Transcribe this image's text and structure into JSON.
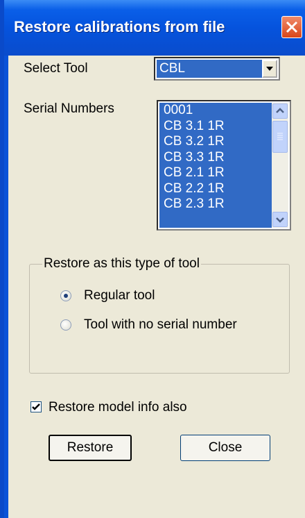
{
  "window": {
    "title": "Restore calibrations from file"
  },
  "select_tool": {
    "label": "Select Tool",
    "value": "CBL"
  },
  "serial_numbers": {
    "label": "Serial Numbers",
    "items": [
      "0001",
      "CB 3.1 1R",
      "CB 3.2 1R",
      "CB 3.3 1R",
      "CB 2.1 1R",
      "CB 2.2 1R",
      "CB 2.3 1R"
    ]
  },
  "restore_type": {
    "title": "Restore as this type of tool",
    "options": [
      {
        "label": "Regular tool",
        "selected": true
      },
      {
        "label": "Tool with no serial number",
        "selected": false
      }
    ]
  },
  "restore_model": {
    "label": "Restore model info also",
    "checked": true
  },
  "buttons": {
    "restore": "Restore",
    "close": "Close"
  },
  "colors": {
    "title_bar": "#0553dd",
    "selection": "#316ac5",
    "dialog_bg": "#ece9d8",
    "close_button": "#d9461a"
  }
}
